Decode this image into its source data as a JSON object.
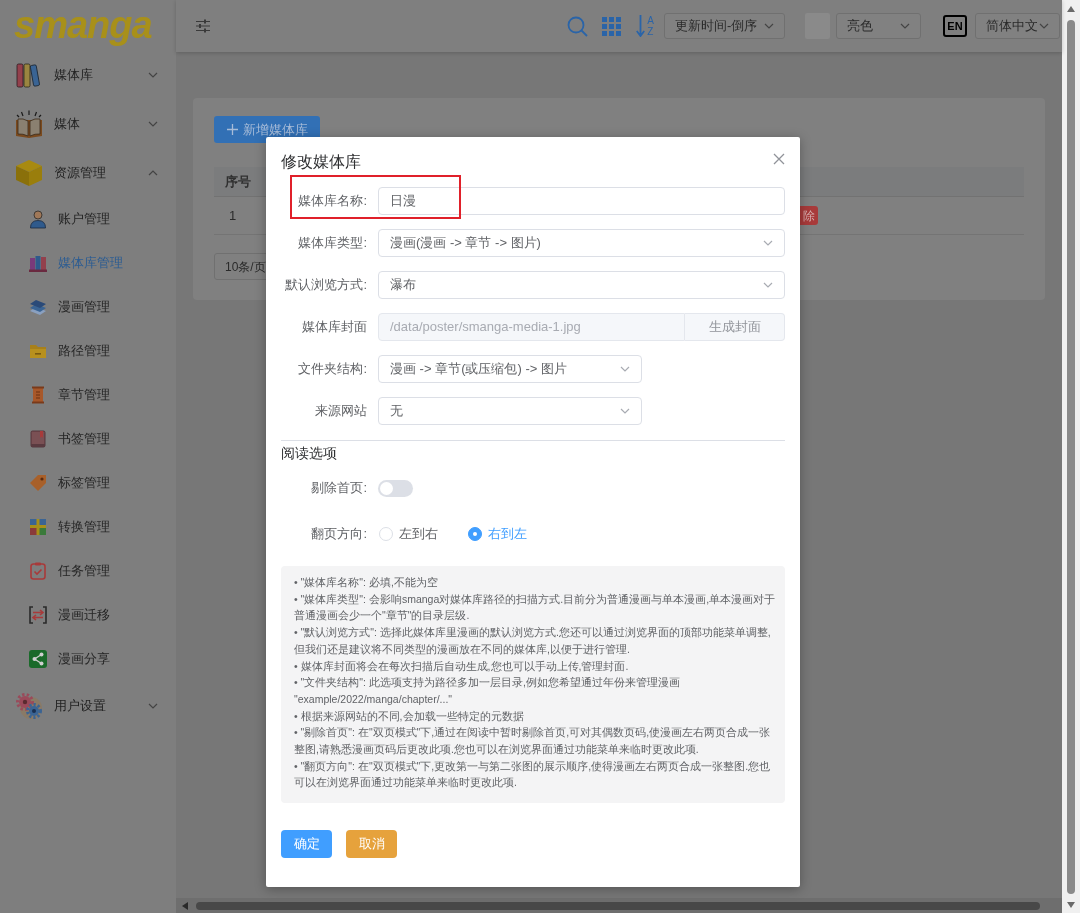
{
  "sidebar": {
    "logo": "smanga",
    "items": [
      {
        "label": "媒体库",
        "expanded": false
      },
      {
        "label": "媒体",
        "expanded": false
      },
      {
        "label": "资源管理",
        "expanded": true,
        "children": [
          {
            "label": "账户管理",
            "selected": false
          },
          {
            "label": "媒体库管理",
            "selected": true
          },
          {
            "label": "漫画管理",
            "selected": false
          },
          {
            "label": "路径管理",
            "selected": false
          },
          {
            "label": "章节管理",
            "selected": false
          },
          {
            "label": "书签管理",
            "selected": false
          },
          {
            "label": "标签管理",
            "selected": false
          },
          {
            "label": "转换管理",
            "selected": false
          },
          {
            "label": "任务管理",
            "selected": false
          },
          {
            "label": "漫画迁移",
            "selected": false
          },
          {
            "label": "漫画分享",
            "selected": false
          }
        ]
      },
      {
        "label": "用户设置",
        "expanded": false
      }
    ]
  },
  "header": {
    "sort_order": {
      "top": "A",
      "bottom": "Z"
    },
    "sort_select": "更新时间-倒序",
    "theme_select": "亮色",
    "language_badge": "EN",
    "language_select": "简体中文"
  },
  "library_page": {
    "add_button": "新增媒体库",
    "table": {
      "columns": [
        "序号"
      ],
      "rows": [
        {
          "cells": [
            "1"
          ],
          "action": "除"
        }
      ]
    },
    "page_size_select": "10条/页"
  },
  "dialog": {
    "title": "修改媒体库",
    "fields": [
      {
        "kind": "input",
        "label": "媒体库名称:",
        "value": "日漫",
        "disabled": false,
        "highlighted": true
      },
      {
        "kind": "select",
        "label": "媒体库类型:",
        "value": "漫画(漫画 -> 章节 -> 图片)",
        "disabled": false,
        "highlighted": false
      },
      {
        "kind": "select",
        "label": "默认浏览方式:",
        "value": "瀑布",
        "disabled": false,
        "highlighted": false
      },
      {
        "kind": "input",
        "label": "媒体库封面",
        "value": "/data/poster/smanga-media-1.jpg",
        "button": "生成封面",
        "disabled": true,
        "highlighted": false
      },
      {
        "kind": "select",
        "label": "文件夹结构:",
        "value": "漫画 -> 章节(或压缩包) -> 图片",
        "disabled": false,
        "highlighted": false
      },
      {
        "kind": "select",
        "label": "来源网站",
        "value": "无",
        "disabled": false,
        "highlighted": false
      }
    ],
    "section_title": "阅读选项",
    "toggle": {
      "label": "剔除首页:",
      "on": false
    },
    "radio_group": {
      "label": "翻页方向:",
      "options": [
        {
          "label": "左到右",
          "selected": false
        },
        {
          "label": "右到左",
          "selected": true
        }
      ]
    },
    "help_lines": [
      "• \"媒体库名称\": 必填,不能为空",
      "• \"媒体库类型\": 会影响smanga对媒体库路径的扫描方式.目前分为普通漫画与单本漫画,单本漫画对于普通漫画会少一个\"章节\"的目录层级.",
      "• \"默认浏览方式\": 选择此媒体库里漫画的默认浏览方式.您还可以通过浏览界面的顶部功能菜单调整,但我们还是建议将不同类型的漫画放在不同的媒体库,以便于进行管理.",
      "• 媒体库封面将会在每次扫描后自动生成,您也可以手动上传,管理封面.",
      "• \"文件夹结构\": 此选项支持为路径多加一层目录,例如您希望通过年份来管理漫画 \"example/2022/manga/chapter/...\"",
      "• 根据来源网站的不同,会加载一些特定的元数据",
      "• \"剔除首页\": 在\"双页模式\"下,通过在阅读中暂时剔除首页,可对其偶数页码,使漫画左右两页合成一张整图,请熟悉漫画页码后更改此项.您也可以在浏览界面通过功能菜单来临时更改此项.",
      "• \"翻页方向\": 在\"双页模式\"下,更改第一与第二张图的展示顺序,使得漫画左右两页合成一张整图.您也可以在浏览界面通过功能菜单来临时更改此项."
    ],
    "buttons": [
      {
        "label": "确定",
        "kind": "primary"
      },
      {
        "label": "取消",
        "kind": "warning"
      }
    ]
  }
}
